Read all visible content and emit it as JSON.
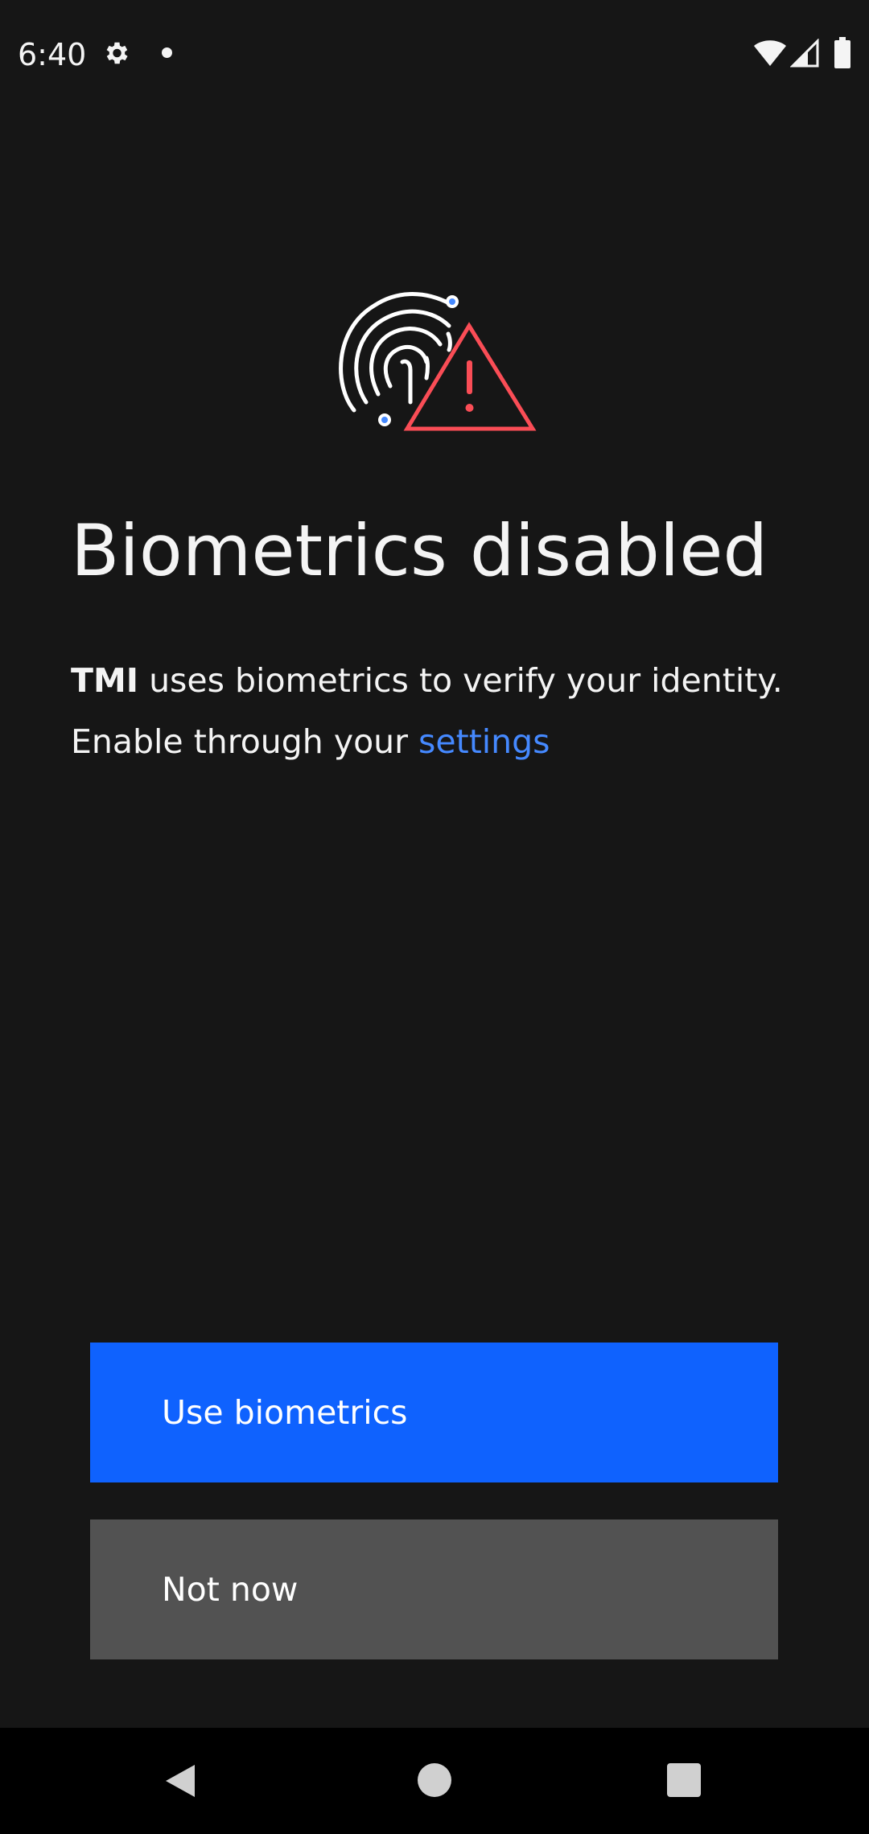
{
  "status_bar": {
    "time": "6:40",
    "icons": [
      "gear-icon",
      "notification-dot-icon",
      "wifi-icon",
      "cell-signal-icon",
      "battery-icon"
    ]
  },
  "hero": {
    "icon": "fingerprint-warning-icon",
    "colors": {
      "fingerprint": "#ffffff",
      "dots": "#4589ff",
      "warning": "#fa4d56"
    }
  },
  "content": {
    "title": "Biometrics disabled",
    "app_name": "TMI",
    "line1_rest": " uses biometrics to verify your identity.",
    "line2_prefix": "Enable through your ",
    "settings_link": "settings"
  },
  "buttons": {
    "primary_label": "Use biometrics",
    "secondary_label": "Not now"
  },
  "colors": {
    "background": "#161616",
    "primary": "#0f62fe",
    "secondary": "#525252",
    "link": "#4589ff"
  },
  "nav_bar": {
    "icons": [
      "back-icon",
      "home-icon",
      "recents-icon"
    ]
  }
}
